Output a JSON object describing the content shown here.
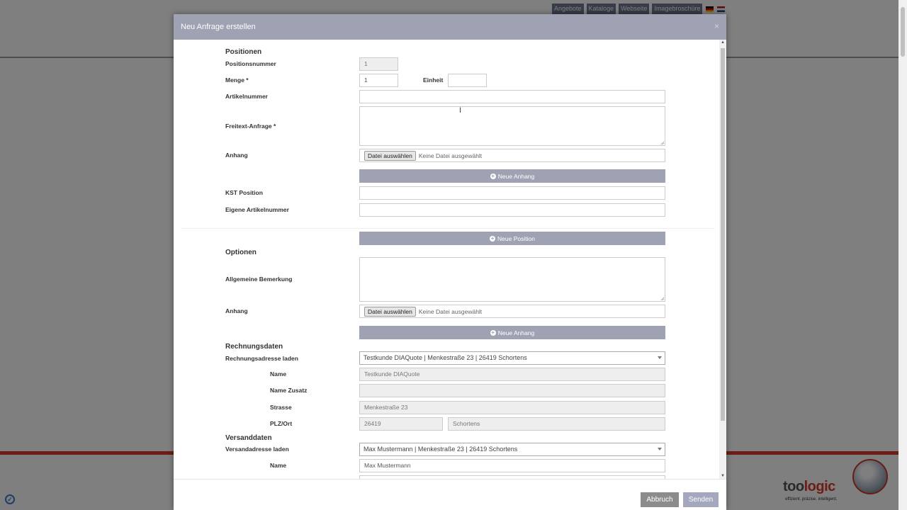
{
  "topnav": {
    "links": [
      "Angebote",
      "Kataloge",
      "Webseite",
      "Imagebroschüre"
    ]
  },
  "brand": {
    "name_part1": "too",
    "name_part2": "logic",
    "tagline": "effizient. präzise. intelligent."
  },
  "modal": {
    "title": "Neu Anfrage erstellen",
    "close": "×"
  },
  "positionen": {
    "heading": "Positionen",
    "positionsnummer": {
      "label": "Positionsnummer",
      "value": "1"
    },
    "menge": {
      "label": "Menge *",
      "value": "1"
    },
    "einheit": {
      "label": "Einheit",
      "value": ""
    },
    "artikelnummer": {
      "label": "Artikelnummer",
      "value": ""
    },
    "freitext": {
      "label": "Freitext-Anfrage *"
    },
    "anhang": {
      "label": "Anhang",
      "button": "Datei auswählen",
      "status": "Keine Datei ausgewählt"
    },
    "neue_anhang": "Neue Anhang",
    "kst_position": {
      "label": "KST Position",
      "value": ""
    },
    "eigene_artikelnummer": {
      "label": "Eigene Artikelnummer",
      "value": ""
    },
    "neue_position": "Neue Position"
  },
  "optionen": {
    "heading": "Optionen",
    "bemerkung": {
      "label": "Allgemeine Bemerkung"
    },
    "anhang": {
      "label": "Anhang",
      "button": "Datei auswählen",
      "status": "Keine Datei ausgewählt"
    },
    "neue_anhang": "Neue Anhang"
  },
  "rechnung": {
    "heading": "Rechnungsdaten",
    "laden": {
      "label": "Rechnungsadresse laden",
      "value": "Testkunde DIAQuote | Menkestraße 23 | 26419 Schortens"
    },
    "name": {
      "label": "Name",
      "value": "Testkunde DIAQuote"
    },
    "zusatz": {
      "label": "Name Zusatz",
      "value": ""
    },
    "strasse": {
      "label": "Strasse",
      "value": "Menkestraße 23"
    },
    "plzort": {
      "label": "PLZ/Ort",
      "plz": "26419",
      "ort": "Schortens"
    }
  },
  "versand": {
    "heading": "Versanddaten",
    "laden": {
      "label": "Versandadresse laden",
      "value": "Max Mustermann | Menkestraße 23 | 26419 Schortens"
    },
    "name": {
      "label": "Name",
      "value": "Max Mustermann"
    }
  },
  "footer": {
    "cancel": "Abbruch",
    "send": "Senden"
  }
}
